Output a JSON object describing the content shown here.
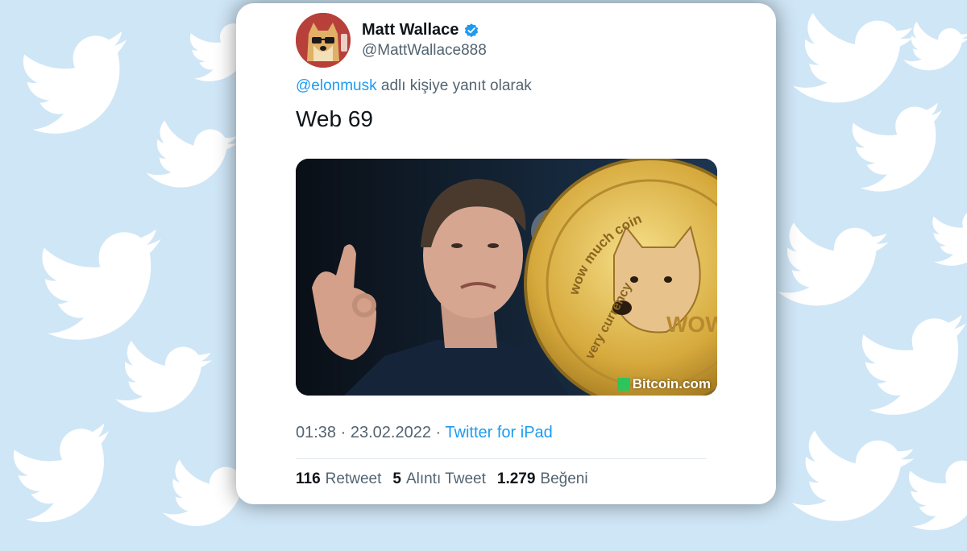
{
  "colors": {
    "background": "#cfe6f6",
    "bird": "#ffffff",
    "link": "#1d9bf0",
    "verified": "#1d9bf0",
    "muted": "#536471",
    "text": "#0f1419"
  },
  "tweet": {
    "author": {
      "display_name": "Matt Wallace",
      "handle": "@MattWallace888",
      "verified": true,
      "avatar_icon": "doge-avatar-icon"
    },
    "reply_to": {
      "mention": "@elonmusk",
      "suffix": "adlı kişiye yanıt olarak"
    },
    "text": "Web 69",
    "media": {
      "watermark": "Bitcoin.com",
      "coin_text": "wow much coin",
      "coin_text_2": "very currency",
      "coin_wow": "WOW"
    },
    "time": "01:38",
    "separator": "·",
    "date": "23.02.2022",
    "source": "Twitter for iPad",
    "stats": [
      {
        "count": "116",
        "label": "Retweet"
      },
      {
        "count": "5",
        "label": "Alıntı Tweet"
      },
      {
        "count": "1.279",
        "label": "Beğeni"
      }
    ]
  }
}
